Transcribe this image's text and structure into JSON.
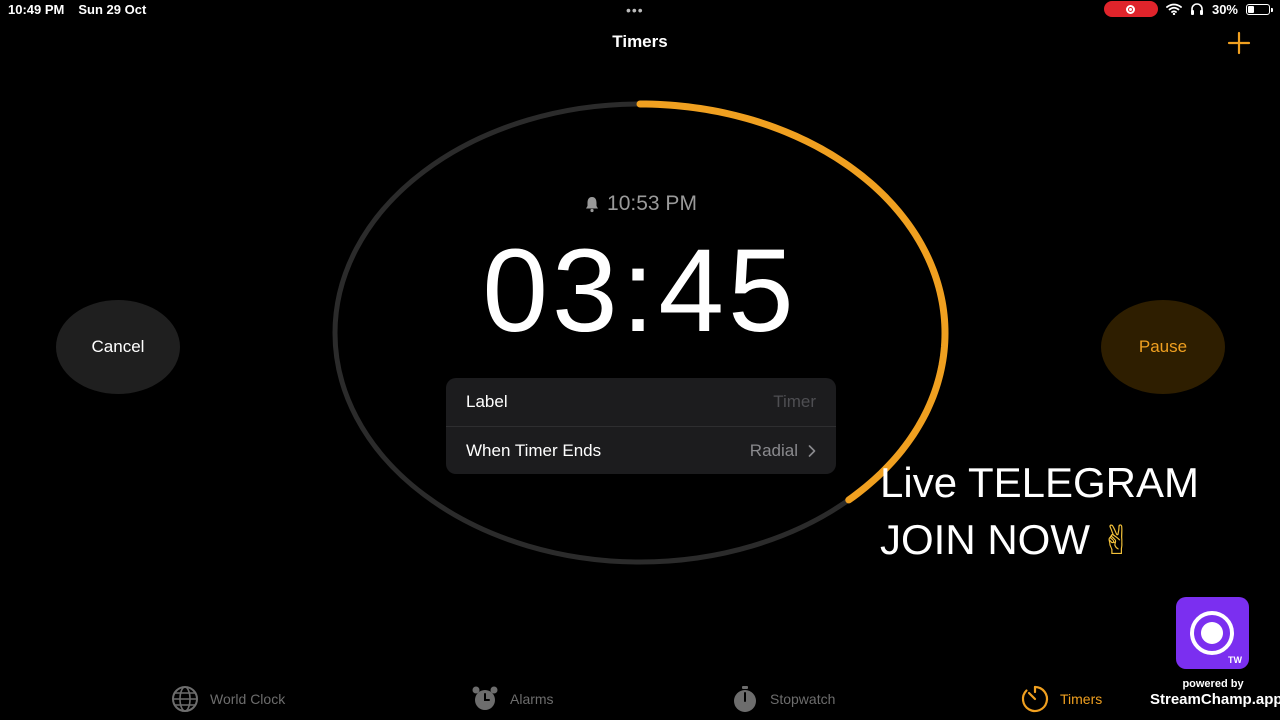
{
  "status_bar": {
    "time": "10:49 PM",
    "date": "Sun 29 Oct",
    "battery": "30%",
    "battery_level": 0.3
  },
  "nav": {
    "title": "Timers"
  },
  "timer": {
    "alarm_time": "10:53 PM",
    "remaining": "03:45",
    "progress_remaining": 0.38
  },
  "options": {
    "label_title": "Label",
    "label_value": "Timer",
    "ends_title": "When Timer Ends",
    "ends_value": "Radial"
  },
  "buttons": {
    "cancel": "Cancel",
    "pause": "Pause"
  },
  "overlay": {
    "line1": "Live TELEGRAM",
    "line2": "JOIN NOW",
    "badge": "TW",
    "powered_by": "powered by",
    "site": "StreamChamp.app"
  },
  "tabs": [
    {
      "label": "World Clock",
      "icon": "globe-icon"
    },
    {
      "label": "Alarms",
      "icon": "alarm-clock-icon"
    },
    {
      "label": "Stopwatch",
      "icon": "stopwatch-icon"
    },
    {
      "label": "Timers",
      "icon": "timer-icon"
    }
  ],
  "colors": {
    "accent": "#f0a020",
    "track": "#2b2b2b",
    "background": "#000000"
  }
}
